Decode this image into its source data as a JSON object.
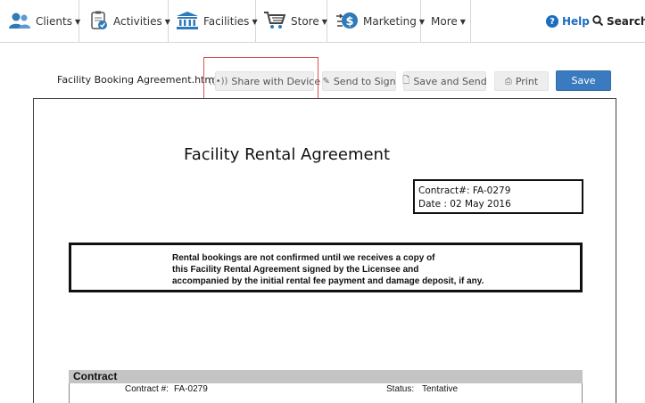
{
  "nav": {
    "items": [
      {
        "label": "Clients",
        "icon": "users-icon"
      },
      {
        "label": "Activities",
        "icon": "clipboard-check-icon"
      },
      {
        "label": "Facilities",
        "icon": "building-icon"
      },
      {
        "label": "Store",
        "icon": "cart-icon"
      },
      {
        "label": "Marketing",
        "icon": "marketing-dollar-icon"
      },
      {
        "label": "More",
        "icon": ""
      }
    ],
    "help_label": "Help",
    "search_label": "Search"
  },
  "toolbar": {
    "file_name": "Facility Booking Agreement.html",
    "share_label": "Share with Device",
    "send_sign_label": "Send to Sign",
    "save_send_label": "Save and Send",
    "print_label": "Print",
    "save_label": "Save"
  },
  "document": {
    "title": "Facility Rental Agreement",
    "contract_line": "Contract#: FA-0279",
    "date_line": "Date : 02 May 2016",
    "notice_lines": [
      "Rental bookings are not confirmed until we receives a copy of",
      "this Facility Rental Agreement signed by the Licensee and",
      "accompanied by the initial rental fee payment and damage deposit, if any."
    ],
    "section_title": "Contract",
    "contract_label": "Contract #:",
    "contract_value": "FA-0279",
    "status_label": "Status:",
    "status_value": "Tentative"
  },
  "colors": {
    "accent": "#3a7bbf",
    "highlight": "#d9534f",
    "help": "#1a6ebf"
  }
}
